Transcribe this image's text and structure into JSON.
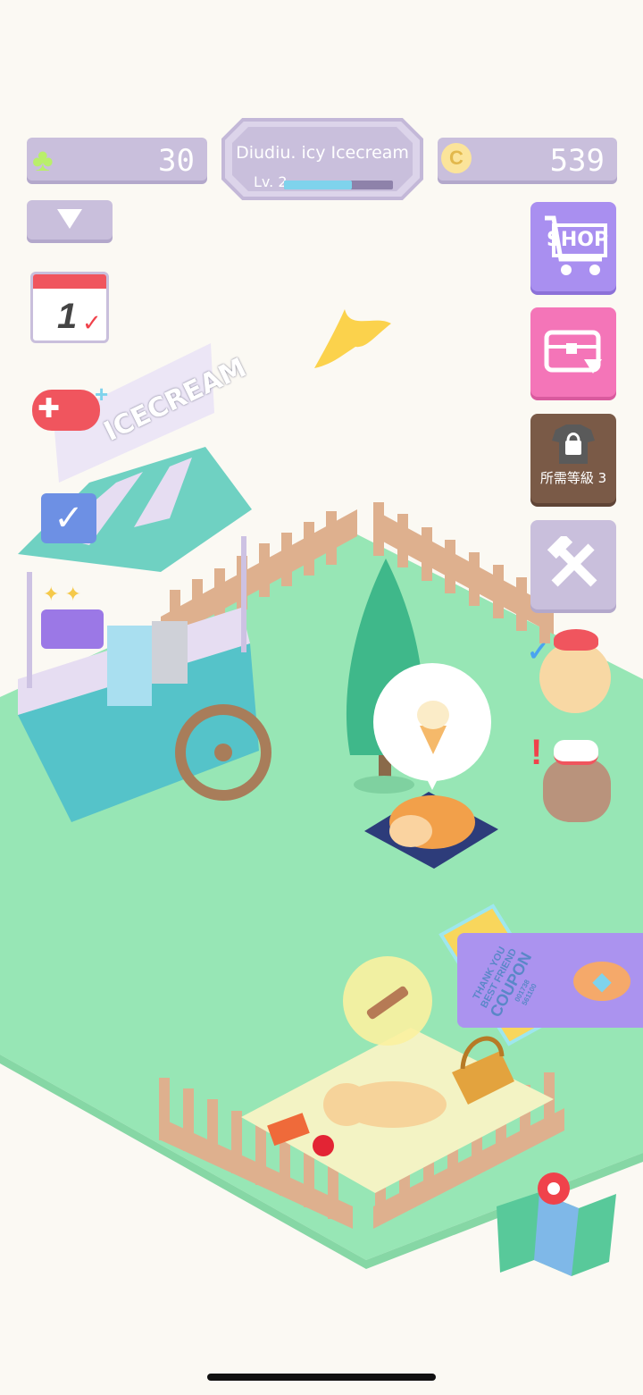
{
  "hud": {
    "clover_count": "30",
    "coin_count": "539",
    "shop_name": "Diudiu. icy Icecream",
    "level_label": "Lv. 2",
    "level_progress": 0.62
  },
  "side_menu": {
    "shop_label": "SHOP",
    "locked_label": "所需等級 3"
  },
  "calendar": {
    "day": "1"
  },
  "cart": {
    "sign": "ICECREAM"
  },
  "coupon": {
    "line1": "THANK YOU",
    "line2": "BEST FRIEND",
    "line3": "COUPON",
    "serial_top": "001738",
    "serial_bottom": "561100"
  },
  "colors": {
    "hud_bg": "#c9bfdc",
    "grass": "#97e6b5",
    "shop_btn": "#a98ff0",
    "gift_btn": "#f475b8",
    "locked_btn": "#7a5a47",
    "tools_btn": "#c9bfdc",
    "progress": "#7fd3ec"
  }
}
